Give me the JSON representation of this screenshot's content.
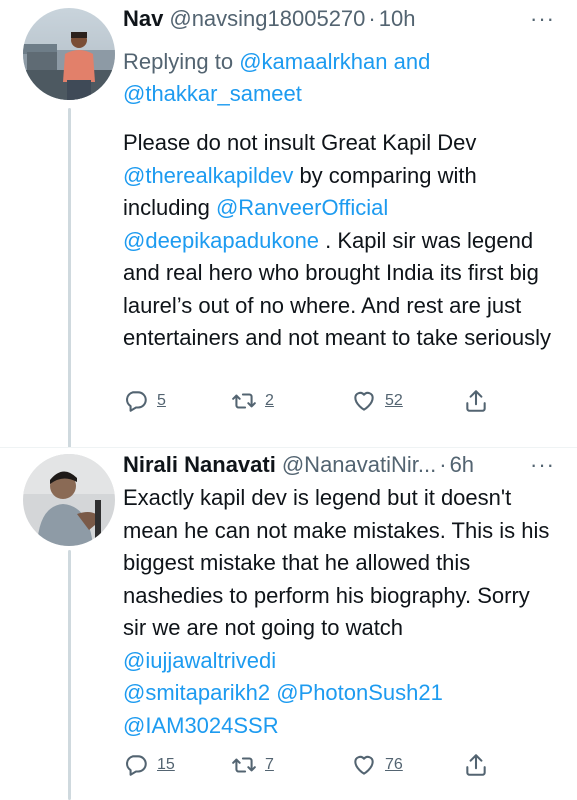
{
  "tweets": [
    {
      "name": "Nav",
      "handle": "@navsing18005270",
      "separator": "·",
      "time": "10h",
      "more": "···",
      "replying_prefix": "Replying to",
      "replying_to": [
        "@kamaalrkhan",
        "@thakkar_sameet"
      ],
      "replying_and": "and",
      "text_line1": "Please do not insult Great Kapil Dev",
      "mention_kapil": "@therealkapildev",
      "text_after_kapil": " by comparing with",
      "text_including": "including ",
      "mention_ranveer": "@RanveerOfficial",
      "mention_deepika": "@deepikapadukone",
      "text_rest_line": " . Kapil sir was",
      "text_rest": "legend and real hero who brought India its first big laurel’s out of no where. And rest are just entertainers and not meant to take seriously",
      "replies": "5",
      "retweets": "2",
      "likes": "52"
    },
    {
      "name": "Nirali Nanavati",
      "handle": "@NanavatiNir...",
      "separator": "·",
      "time": "6h",
      "more": "···",
      "text_body": "Exactly kapil dev is legend but it doesn't mean he can not make mistakes. This is his biggest mistake that he allowed this nashedies to perform his biography. Sorry sir we are not going to watch ",
      "mentions": [
        "@iujjawaltrivedi",
        "@smitaparikh2",
        "@PhotonSush21",
        "@IAM3024SSR"
      ],
      "replies": "15",
      "retweets": "7",
      "likes": "76"
    }
  ],
  "icons": {
    "reply": "reply-icon",
    "retweet": "retweet-icon",
    "like": "heart-icon",
    "share": "share-icon",
    "more": "more-icon"
  },
  "colors": {
    "link": "#1d9bf0",
    "secondary": "#536471",
    "text": "#0f1419",
    "thread_line": "#cfd9de",
    "divider": "#eff3f4"
  }
}
